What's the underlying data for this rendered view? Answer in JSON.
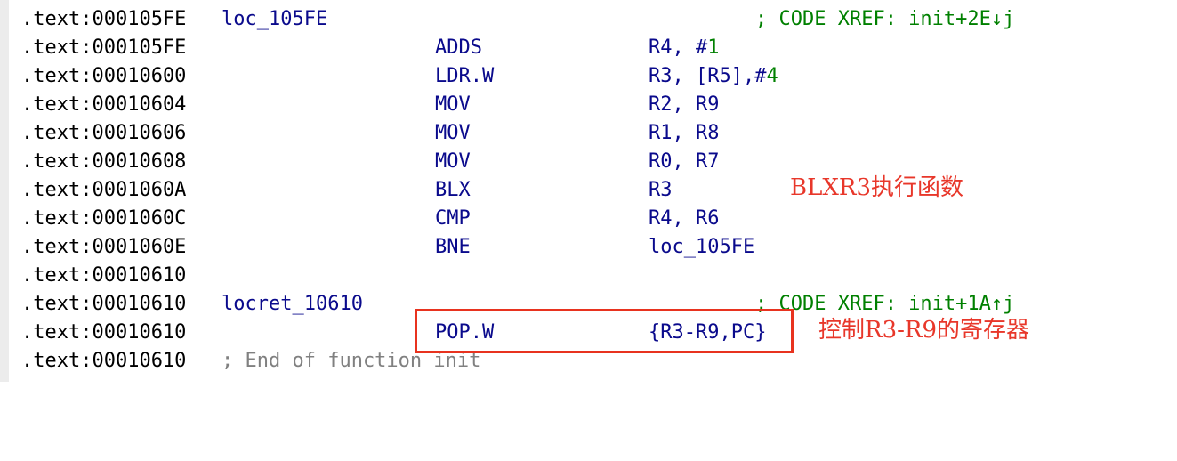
{
  "lines": [
    {
      "address": ".text:000105FE",
      "label": "loc_105FE",
      "mnemonic": "",
      "operand": "",
      "comment": "; CODE XREF: init+2E↓j"
    },
    {
      "address": ".text:000105FE",
      "label": "",
      "mnemonic": "ADDS",
      "operand": "R4, #",
      "operand_num": "1",
      "comment": ""
    },
    {
      "address": ".text:00010600",
      "label": "",
      "mnemonic": "LDR.W",
      "operand": "R3, [R5],#",
      "operand_num": "4",
      "comment": ""
    },
    {
      "address": ".text:00010604",
      "label": "",
      "mnemonic": "MOV",
      "operand": "R2, R9",
      "comment": ""
    },
    {
      "address": ".text:00010606",
      "label": "",
      "mnemonic": "MOV",
      "operand": "R1, R8",
      "comment": ""
    },
    {
      "address": ".text:00010608",
      "label": "",
      "mnemonic": "MOV",
      "operand": "R0, R7",
      "comment": ""
    },
    {
      "address": ".text:0001060A",
      "label": "",
      "mnemonic": "BLX",
      "operand": "R3",
      "comment": ""
    },
    {
      "address": ".text:0001060C",
      "label": "",
      "mnemonic": "CMP",
      "operand": "R4, R6",
      "comment": ""
    },
    {
      "address": ".text:0001060E",
      "label": "",
      "mnemonic": "BNE",
      "operand": "loc_105FE",
      "comment": ""
    },
    {
      "address": ".text:00010610",
      "label": "",
      "mnemonic": "",
      "operand": "",
      "comment": ""
    },
    {
      "address": ".text:00010610",
      "label": "locret_10610",
      "mnemonic": "",
      "operand": "",
      "comment": "; CODE XREF: init+1A↑j"
    },
    {
      "address": ".text:00010610",
      "label": "",
      "mnemonic": "POP.W",
      "operand": "{R3-R9,PC}",
      "comment": ""
    },
    {
      "address": ".text:00010610",
      "label": "",
      "mnemonic": "",
      "operand": "",
      "comment": "",
      "end_comment": "; End of function init"
    }
  ],
  "annotations": {
    "blx_note": "BLXR3执行函数",
    "pop_note": "控制R3-R9的寄存器"
  },
  "colors": {
    "address": "#000000",
    "code": "#0a0a8c",
    "xref_comment": "#008000",
    "immediate": "#008000",
    "end_comment": "#808080",
    "annotation": "#e8372a",
    "highlight_box": "#e8331f"
  }
}
